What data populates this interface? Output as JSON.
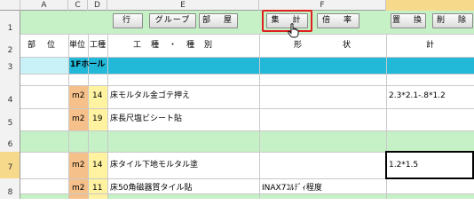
{
  "columns": [
    "A",
    "C",
    "D",
    "E",
    "F"
  ],
  "rows": [
    "1",
    "2",
    "3",
    "4",
    "5",
    "6",
    "7",
    "8"
  ],
  "toolbar": {
    "gyo": "行",
    "group": "グループ",
    "heya": "部　屋",
    "shukei": "集　計",
    "bairitsu": "倍　率",
    "chikan": "置　換",
    "sakujo": "削　除"
  },
  "headers": {
    "bui": "部　位",
    "tani": "単位",
    "koshu": "工種",
    "koshu_shubetsu": "工　種　・　種　別",
    "keijo": "形　　　　状",
    "kei": "計"
  },
  "section_title": "1Fホール",
  "table": [
    {
      "unit": "m2",
      "code": "14",
      "name": "床モルタル金ゴテ押え",
      "shape": "",
      "calc": "2.3*2.1-.8*1.2"
    },
    {
      "unit": "m2",
      "code": "19",
      "name": "床長尺塩ビシート貼",
      "shape": "",
      "calc": ""
    },
    {
      "unit": "m2",
      "code": "14",
      "name": "床タイル下地モルタル塗",
      "shape": "",
      "calc": "1.2*1.5"
    },
    {
      "unit": "m2",
      "code": "11",
      "name": "床50角磁器質タイル貼",
      "shape": "INAX7ｺﾙﾃﾞｨ程度",
      "calc": ""
    }
  ],
  "colors": {
    "green": "#c6f0c6",
    "cyan": "#22b8d8",
    "light_cyan": "#c8f2f8",
    "orange": "#f6c08a",
    "yellow": "#fff2a0",
    "highlight_red": "#e02020"
  }
}
